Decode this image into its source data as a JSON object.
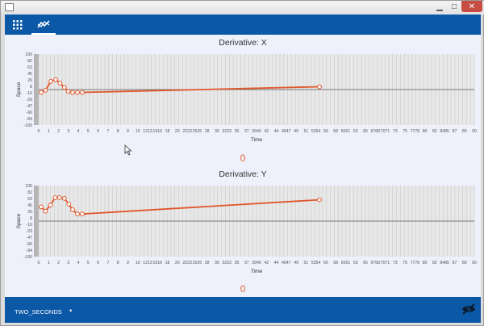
{
  "toolbar": {
    "icons": [
      "grid-icon",
      "chart-icon"
    ],
    "active": "chart"
  },
  "charts": [
    {
      "title": "Derivative: X",
      "xlabel": "Time",
      "ylabel": "Space",
      "readout": "0"
    },
    {
      "title": "Derivative: Y",
      "xlabel": "Time",
      "ylabel": "Space",
      "readout": "0"
    }
  ],
  "chart_data": [
    {
      "type": "line",
      "title": "Derivative: X",
      "xlabel": "Time",
      "ylabel": "Space",
      "ylim": [
        -100,
        100
      ],
      "yticks": [
        "100",
        "82",
        "63",
        "45",
        "26",
        "8",
        "-10",
        "-29",
        "-47",
        "-66",
        "-84",
        "-100"
      ],
      "xticks": [
        "0",
        "1",
        "2",
        "3",
        "4",
        "5",
        "6",
        "7",
        "8",
        "9",
        "10",
        "1213",
        "1516",
        "18",
        "20",
        "2223",
        "2526",
        "28",
        "30",
        "3233",
        "35",
        "37",
        "3940",
        "42",
        "44",
        "4647",
        "49",
        "51",
        "5354",
        "56",
        "58",
        "6061",
        "63",
        "65",
        "6768",
        "7071",
        "73",
        "75",
        "7778",
        "80",
        "82",
        "8485",
        "87",
        "89",
        "90"
      ],
      "grid": true,
      "series": [
        {
          "color": "#e0572b",
          "x": [
            0.5,
            1.4,
            2.5,
            3.5,
            4.4,
            5.3,
            6.1,
            7,
            8,
            9,
            58
          ],
          "y": [
            -8,
            -2,
            23,
            28,
            18,
            6,
            -5,
            -8,
            -8,
            -8,
            8
          ]
        }
      ]
    },
    {
      "type": "line",
      "title": "Derivative: Y",
      "xlabel": "Time",
      "ylabel": "Space",
      "ylim": [
        -100,
        100
      ],
      "yticks": [
        "100",
        "82",
        "63",
        "45",
        "26",
        "8",
        "-10",
        "-29",
        "-47",
        "-66",
        "-84",
        "-100"
      ],
      "xticks": [
        "0",
        "1",
        "2",
        "3",
        "4",
        "5",
        "6",
        "7",
        "8",
        "9",
        "10",
        "1213",
        "1516",
        "18",
        "20",
        "2223",
        "2526",
        "28",
        "30",
        "3233",
        "35",
        "37",
        "3940",
        "42",
        "44",
        "4647",
        "49",
        "51",
        "5354",
        "56",
        "58",
        "6061",
        "63",
        "65",
        "6768",
        "7071",
        "73",
        "75",
        "7778",
        "80",
        "82",
        "8485",
        "87",
        "89",
        "90"
      ],
      "grid": true,
      "series": [
        {
          "color": "#e0572b",
          "x": [
            0.5,
            1.4,
            2.4,
            3.4,
            4.3,
            5.3,
            6.2,
            7,
            8,
            9,
            58
          ],
          "y": [
            40,
            28,
            45,
            66,
            66,
            64,
            48,
            32,
            20,
            20,
            60
          ]
        }
      ]
    }
  ],
  "bottombar": {
    "dropdown_value": "TWO_SECONDS",
    "dropdown_icon": "chevron-down-icon",
    "toggle_icon": "eye-off-icon"
  },
  "colors": {
    "accent": "#0b58a6",
    "series": "#e0572b",
    "readout": "#e2693a",
    "plot_bg": "#e8e8e8",
    "grid": "#c9c9c9"
  }
}
